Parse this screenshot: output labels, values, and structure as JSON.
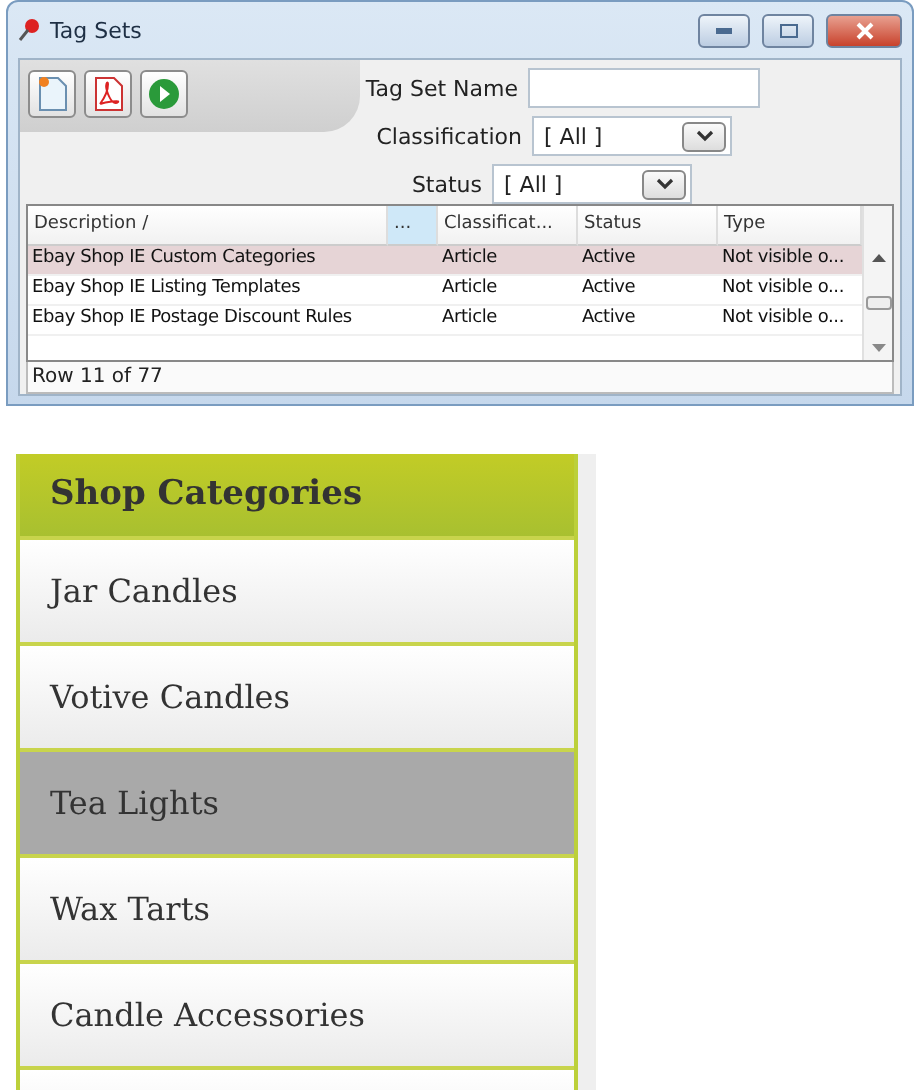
{
  "window": {
    "title": "Tag Sets"
  },
  "filters": [
    {
      "kind": "text",
      "label": "Tag Set Name"
    },
    {
      "kind": "select",
      "label": "Classification",
      "value": "[ All ]"
    },
    {
      "kind": "select",
      "label": "Status",
      "value": "[ All ]"
    }
  ],
  "table": {
    "columns": [
      {
        "label": "Description /",
        "highlighted": false
      },
      {
        "label": "...",
        "highlighted": true
      },
      {
        "label": "Classificat...",
        "highlighted": false
      },
      {
        "label": "Status",
        "highlighted": false
      },
      {
        "label": "Type",
        "highlighted": false
      }
    ],
    "rows": [
      {
        "selected": true,
        "cells": [
          "Ebay Shop IE Custom Categories",
          "",
          "Article",
          "Active",
          "Not visible o..."
        ]
      },
      {
        "selected": false,
        "cells": [
          "Ebay Shop IE Listing Templates",
          "",
          "Article",
          "Active",
          "Not visible o..."
        ]
      },
      {
        "selected": false,
        "cells": [
          "Ebay Shop IE Postage Discount Rules",
          "",
          "Article",
          "Active",
          "Not visible o..."
        ]
      }
    ]
  },
  "status_bar": "Row 11 of 77",
  "categories": {
    "title": "Shop Categories",
    "items": [
      {
        "label": "Jar Candles",
        "selected": false
      },
      {
        "label": "Votive Candles",
        "selected": false
      },
      {
        "label": "Tea Lights",
        "selected": true
      },
      {
        "label": "Wax Tarts",
        "selected": false
      },
      {
        "label": "Candle Accessories",
        "selected": false
      }
    ]
  }
}
